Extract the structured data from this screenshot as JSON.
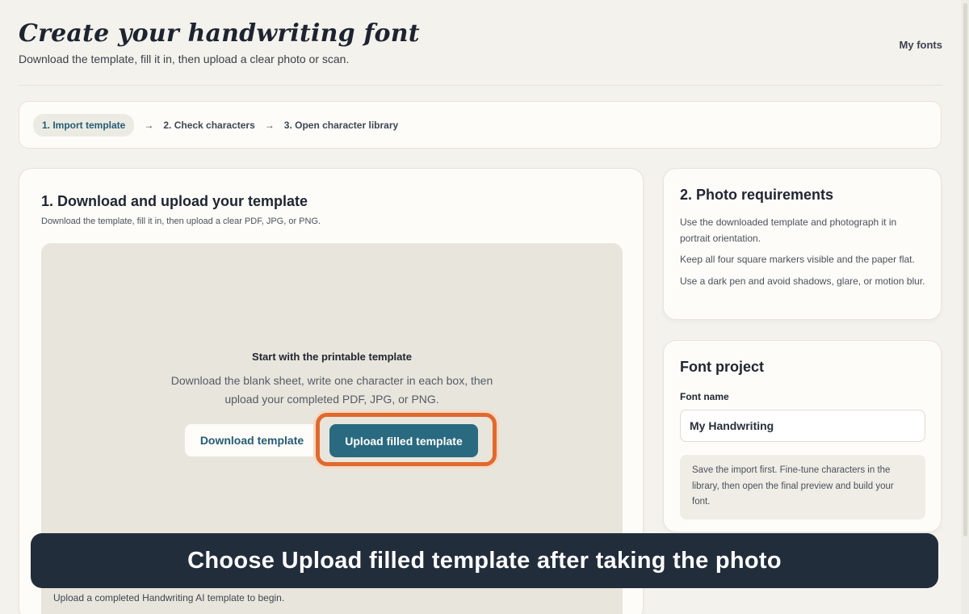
{
  "header": {
    "title": "Create your handwriting font",
    "subtitle": "Download the template, fill it in, then upload a clear photo or scan.",
    "my_fonts": "My fonts"
  },
  "steps": [
    {
      "label": "1. Import template",
      "active": true
    },
    {
      "label": "2. Check characters",
      "active": false
    },
    {
      "label": "3. Open character library",
      "active": false
    }
  ],
  "step_arrow": "→",
  "main": {
    "title": "1. Download and upload your template",
    "subtitle": "Download the template, fill it in, then upload a clear PDF, JPG, or PNG.",
    "dropzone": {
      "title": "Start with the printable template",
      "text": "Download the blank sheet, write one character in each box, then upload your completed PDF, JPG, or PNG.",
      "download_label": "Download template",
      "upload_label": "Upload filled template",
      "footer": "Upload a completed Handwriting AI template to begin."
    }
  },
  "requirements": {
    "title": "2. Photo requirements",
    "items": [
      "Use the downloaded template and photograph it in portrait orientation.",
      "Keep all four square markers visible and the paper flat.",
      "Use a dark pen and avoid shadows, glare, or motion blur."
    ]
  },
  "project": {
    "title": "Font project",
    "font_name_label": "Font name",
    "font_name_value": "My Handwriting",
    "note": "Save the import first. Fine-tune characters in the library, then open the final preview and build your font."
  },
  "caption": "Choose Upload filled template after taking the photo",
  "colors": {
    "accent": "#2a6a80",
    "highlight": "#e06a2e",
    "background": "#f4f2ec",
    "caption_bg": "#222d3c"
  }
}
